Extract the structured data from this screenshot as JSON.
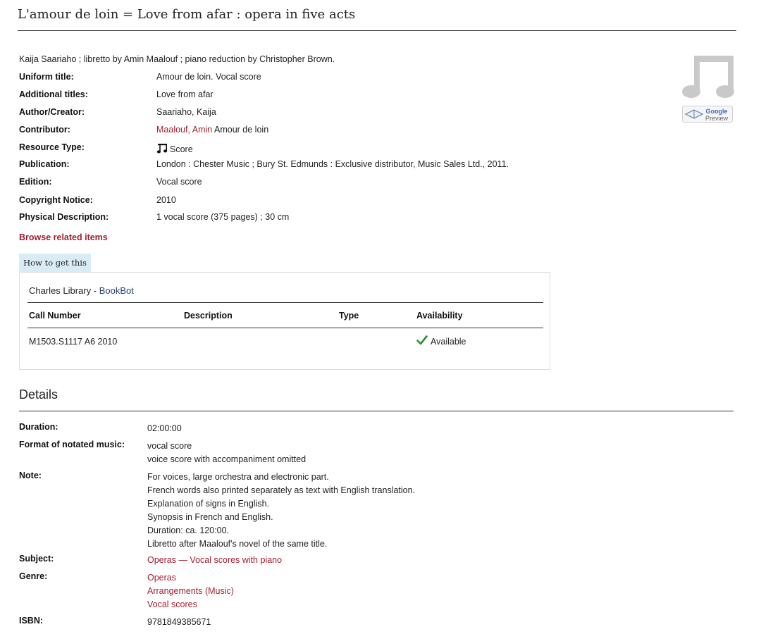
{
  "title": "L'amour de loin = Love from afar : opera in five acts",
  "statement": "Kaija Saariaho ; libretto by Amin Maalouf ; piano reduction by Christopher Brown.",
  "fields": {
    "uniform_title": {
      "label": "Uniform title:",
      "value": "Amour de loin. Vocal score"
    },
    "additional_titles": {
      "label": "Additional titles:",
      "value": "Love from afar"
    },
    "author": {
      "label": "Author/Creator:",
      "value": "Saariaho, Kaija"
    },
    "contributor": {
      "label": "Contributor:",
      "link": "Maalouf, Amin",
      "extra": "Amour de loin"
    },
    "resource_type": {
      "label": "Resource Type:",
      "value": "Score",
      "icon": "music-note-icon"
    },
    "publication": {
      "label": "Publication:",
      "value": "London : Chester Music ; Bury St. Edmunds : Exclusive distributor, Music Sales Ltd., 2011."
    },
    "edition": {
      "label": "Edition:",
      "value": "Vocal score"
    },
    "copyright": {
      "label": "Copyright Notice:",
      "value": "2010"
    },
    "physical": {
      "label": "Physical Description:",
      "value": "1 vocal score (375 pages) ; 30 cm"
    }
  },
  "browse_label": "Browse related items",
  "google_preview": {
    "line1": "Google",
    "line2": "Preview"
  },
  "holdings": {
    "tab_label": "How to get this",
    "library": "Charles Library",
    "location": "BookBot",
    "columns": [
      "Call Number",
      "Description",
      "Type",
      "Availability"
    ],
    "rows": [
      {
        "call_number": "M1503.S1117 A6 2010",
        "description": "",
        "type": "",
        "availability": "Available"
      }
    ]
  },
  "details": {
    "heading": "Details",
    "duration": {
      "label": "Duration:",
      "values": [
        "02:00:00"
      ]
    },
    "format": {
      "label": "Format of notated music:",
      "values": [
        "vocal score",
        "voice score with accompaniment omitted"
      ]
    },
    "note": {
      "label": "Note:",
      "values": [
        "For voices, large orchestra and electronic part.",
        "French words also printed separately as text with English translation.",
        "Explanation of signs in English.",
        "Synopsis in French and English.",
        "Duration: ca. 120:00.",
        "Libretto after Maalouf's novel of the same title."
      ]
    },
    "subject": {
      "label": "Subject:",
      "values": [
        "Operas — Vocal scores with piano"
      ]
    },
    "genre": {
      "label": "Genre:",
      "values": [
        "Operas",
        "Arrangements (Music)",
        "Vocal scores"
      ]
    },
    "isbn": {
      "label": "ISBN:",
      "values": [
        "9781849385671"
      ]
    }
  },
  "colors": {
    "link": "#a41e2e",
    "tab_bg": "#d9ecf5",
    "available": "#2e8b2e"
  }
}
